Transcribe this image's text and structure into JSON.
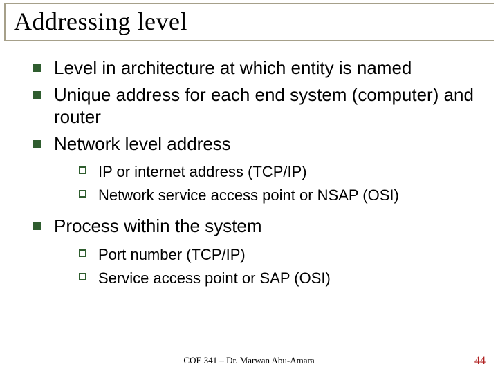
{
  "title": "Addressing level",
  "bullets": {
    "b0": "Level in architecture at which entity is named",
    "b1": "Unique address for each end system (computer) and router",
    "b2": "Network level address",
    "b2_sub": {
      "s0": "IP or internet address (TCP/IP)",
      "s1": "Network service access point or NSAP (OSI)"
    },
    "b3": "Process within the system",
    "b3_sub": {
      "s0": "Port number (TCP/IP)",
      "s1": "Service access point or SAP (OSI)"
    }
  },
  "footer": "COE 341 – Dr. Marwan Abu-Amara",
  "page_number": "44",
  "colors": {
    "bullet": "#2f5d2f",
    "rule": "#a6a08a",
    "pagenum": "#b02020"
  }
}
